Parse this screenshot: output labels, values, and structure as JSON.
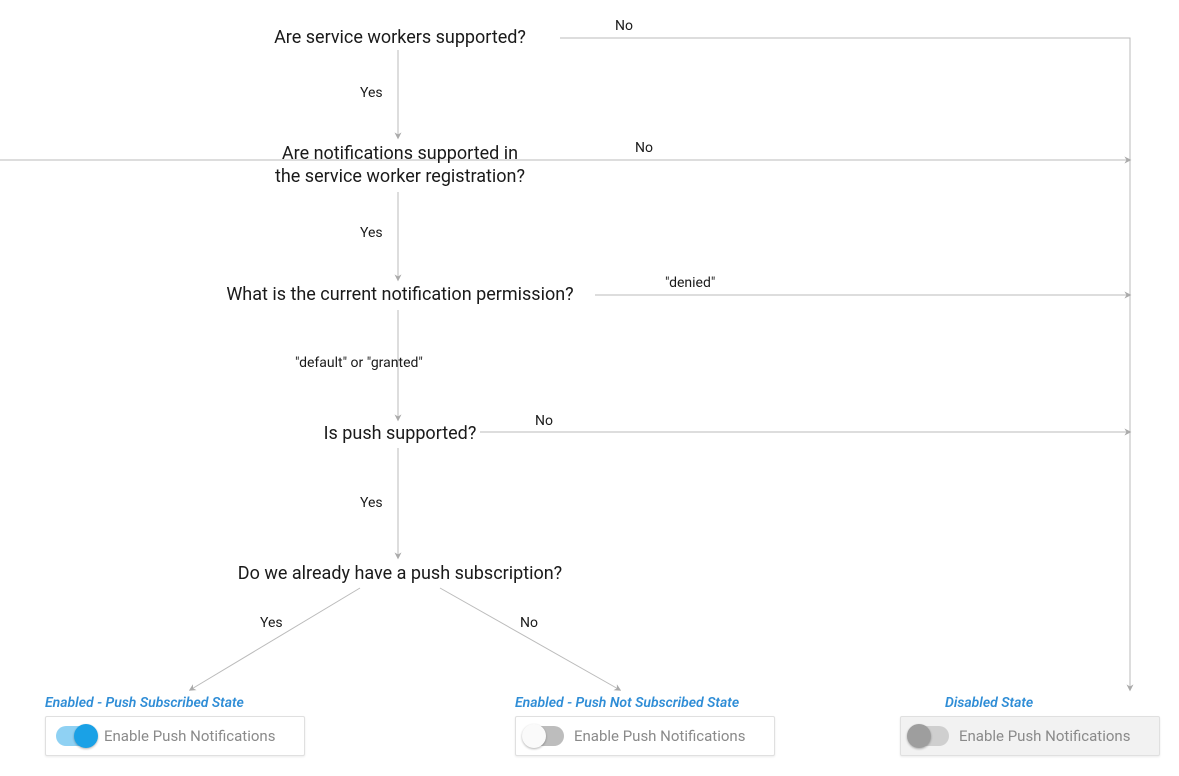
{
  "nodes": {
    "q1": "Are service workers supported?",
    "q2": "Are notifications supported in\nthe service worker registration?",
    "q3": "What is the current notification permission?",
    "q4": "Is push supported?",
    "q5": "Do we already have a push subscription?"
  },
  "edges": {
    "yes": "Yes",
    "no": "No",
    "denied": "\"denied\"",
    "defaultOrGranted": "\"default\" or \"granted\""
  },
  "states": {
    "subscribed": {
      "title": "Enabled - Push Subscribed State",
      "label": "Enable Push Notifications"
    },
    "notSubscribed": {
      "title": "Enabled - Push Not Subscribed State",
      "label": "Enable Push Notifications"
    },
    "disabled": {
      "title": "Disabled State",
      "label": "Enable Push Notifications"
    }
  }
}
